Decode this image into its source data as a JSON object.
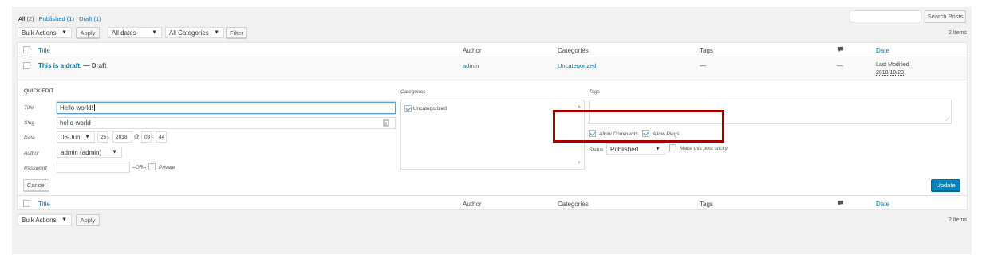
{
  "views": {
    "all": "All",
    "all_count": "(2)",
    "published": "Published",
    "published_count": "(1)",
    "draft": "Draft",
    "draft_count": "(1)",
    "sep": "|"
  },
  "search": {
    "placeholder": "",
    "button": "Search Posts"
  },
  "top_filters": {
    "bulk_actions": "Bulk Actions",
    "apply": "Apply",
    "dates": "All dates",
    "categories": "All Categories",
    "filter": "Filter",
    "items_count": "2 Items"
  },
  "columns": {
    "title": "Title",
    "author": "Author",
    "categories": "Categories",
    "tags": "Tags",
    "date": "Date"
  },
  "row": {
    "title": "This is a draft.",
    "state": "— Draft",
    "author": "admin",
    "category": "Uncategorized",
    "tags": "—",
    "comments": "—",
    "date_label": "Last Modified",
    "date_value": "2018/10/23"
  },
  "quick_edit": {
    "heading": "QUICK EDIT",
    "title_label": "Title",
    "title_value": "Hello world!",
    "slug_label": "Slug",
    "slug_value": "hello-world",
    "date_label": "Date",
    "month_value": "06-Jun",
    "day_value": "25",
    "year_value": "2018",
    "at": "@",
    "hour_value": "08",
    "colon": ":",
    "minute_value": "44",
    "author_label": "Author",
    "author_value": "admin (admin)",
    "password_label": "Password",
    "password_value": "",
    "or_text": "–OR–",
    "private_label": "Private",
    "cancel": "Cancel",
    "categories_label": "Categories",
    "category_item": "Uncategorized",
    "tags_label": "Tags",
    "tags_value": "",
    "allow_comments": "Allow Comments",
    "allow_pings": "Allow Pings",
    "status_label": "Status",
    "status_value": "Published",
    "sticky_label": "Make this post sticky",
    "update": "Update"
  },
  "bottom": {
    "bulk_actions": "Bulk Actions",
    "apply": "Apply",
    "items_count": "2 Items"
  },
  "colors": {
    "highlight": "#a50000",
    "primary": "#0085ba",
    "link": "#0073aa"
  },
  "icons": {
    "comment": "speech-bubble-icon",
    "dropdown": "chevron-down-icon",
    "key": "key-icon"
  }
}
